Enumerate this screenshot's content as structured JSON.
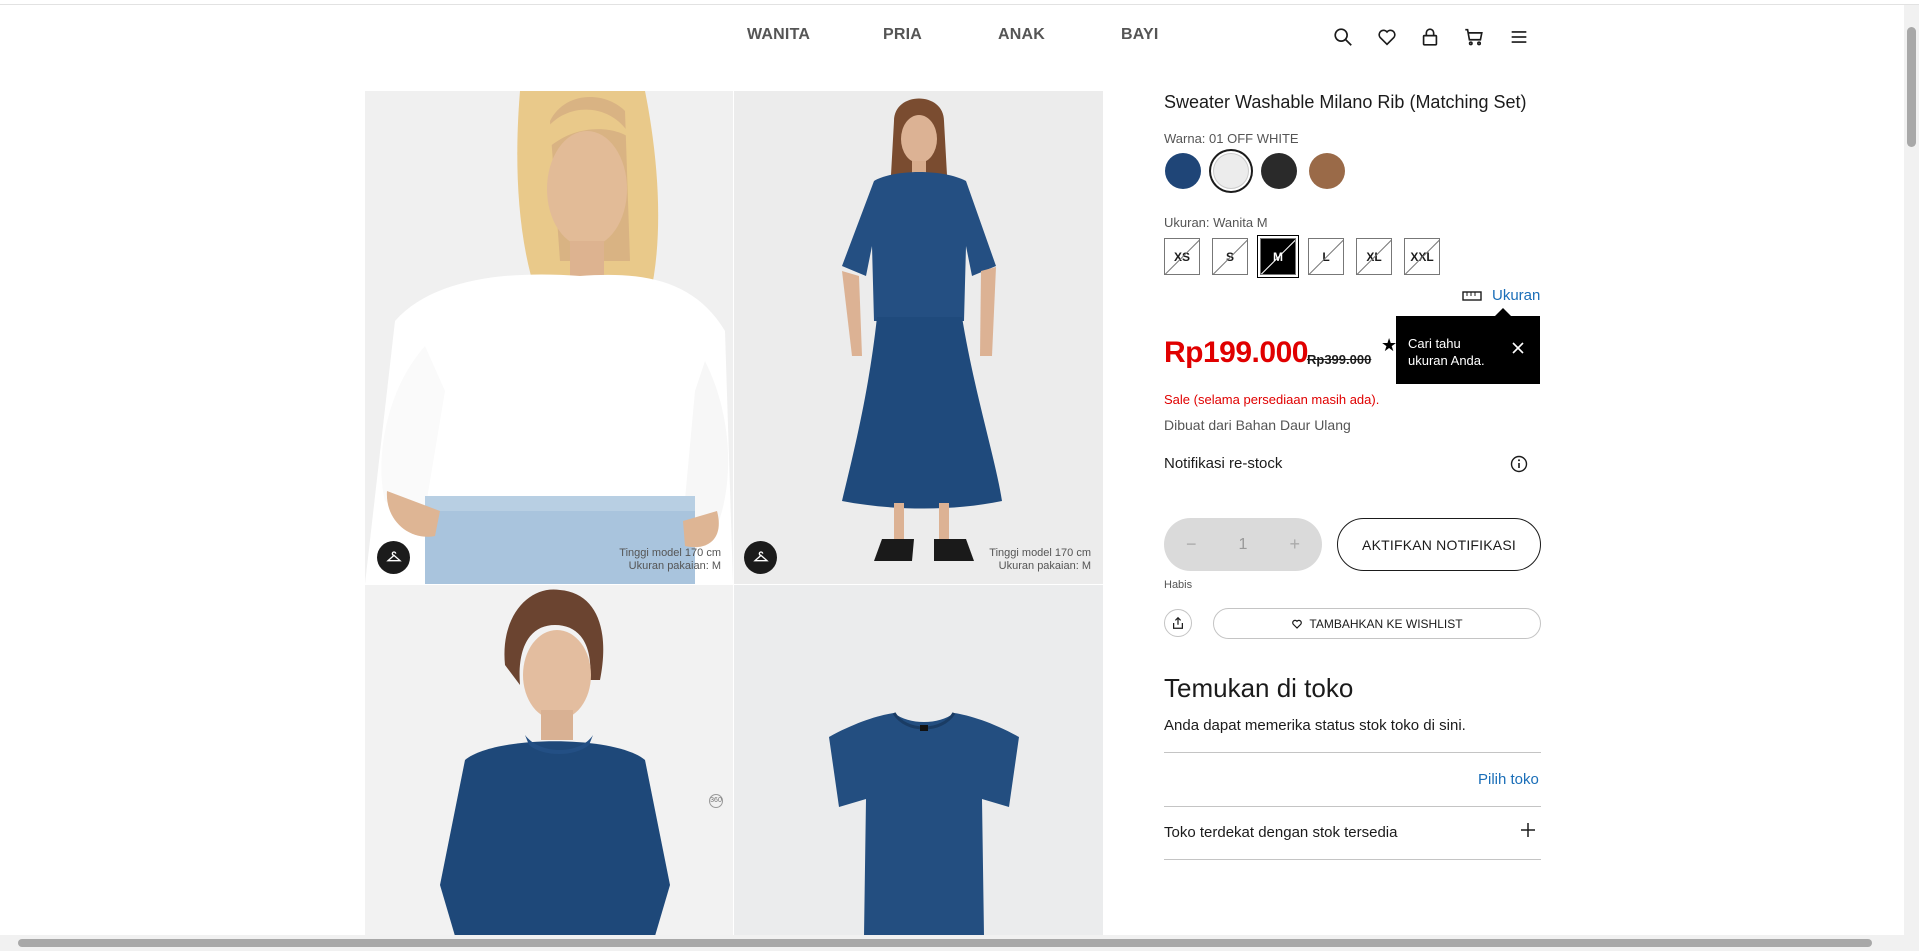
{
  "nav": {
    "items": [
      "WANITA",
      "PRIA",
      "ANAK",
      "BAYI"
    ],
    "icons": [
      "search-icon",
      "heart-icon",
      "lock-icon",
      "cart-icon",
      "menu-icon"
    ]
  },
  "gallery": {
    "tile1": {
      "model_height": "Tinggi model 170 cm",
      "model_size": "Ukuran pakaian: M"
    },
    "tile2": {
      "model_height": "Tinggi model 170 cm",
      "model_size": "Ukuran pakaian: M"
    }
  },
  "product": {
    "title": "Sweater Washable Milano Rib (Matching Set)",
    "color_label": "Warna: 01 OFF WHITE",
    "colors": [
      {
        "name": "navy",
        "hex": "#1f4577"
      },
      {
        "name": "off-white",
        "hex": "#ececec",
        "selected": true
      },
      {
        "name": "black",
        "hex": "#2a2a2a"
      },
      {
        "name": "brown",
        "hex": "#9a6a48"
      }
    ],
    "size_label": "Ukuran: Wanita M",
    "sizes": [
      "XS",
      "S",
      "M",
      "L",
      "XL",
      "XXL"
    ],
    "selected_size": "M",
    "size_guide": "Ukuran",
    "tooltip": "Cari tahu ukuran Anda.",
    "price": "Rp199.000",
    "old_price": "Rp399.000",
    "sale_note": "Sale (selama persediaan masih ada).",
    "recycled_note": "Dibuat dari Bahan Daur Ulang",
    "restock_label": "Notifikasi re-stock",
    "quantity": "1",
    "notify_button": "AKTIFKAN NOTIFIKASI",
    "stock_status": "Habis",
    "wishlist_button": "TAMBAHKAN KE WISHLIST"
  },
  "store": {
    "heading": "Temukan di toko",
    "subtext": "Anda dapat memerika status stok toko di sini.",
    "pick_store": "Pilih toko",
    "nearby": "Toko terdekat dengan stok tersedia"
  },
  "colors": {
    "sale_red": "#e00000",
    "link_blue": "#1a6eb8",
    "text": "#1b1b1b"
  }
}
